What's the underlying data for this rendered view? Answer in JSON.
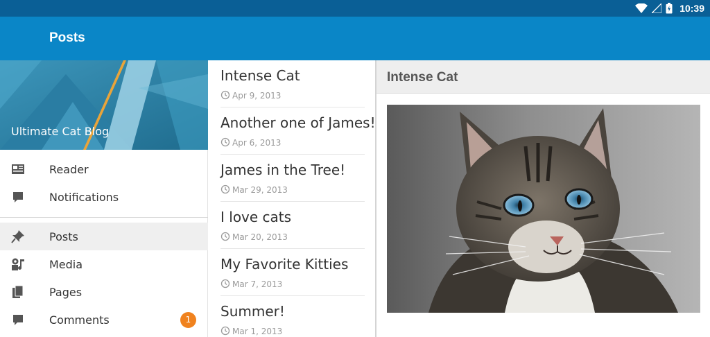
{
  "status_bar": {
    "time": "10:39",
    "icons": [
      "wifi-icon",
      "cell-signal-icon",
      "battery-icon"
    ]
  },
  "app_bar": {
    "title": "Posts"
  },
  "sidebar": {
    "blog_name": "Ultimate Cat Blog",
    "items": [
      {
        "label": "Reader",
        "icon": "reader-icon"
      },
      {
        "label": "Notifications",
        "icon": "notifications-icon"
      },
      {
        "label": "Posts",
        "icon": "pin-icon",
        "selected": true
      },
      {
        "label": "Media",
        "icon": "media-icon"
      },
      {
        "label": "Pages",
        "icon": "pages-icon"
      },
      {
        "label": "Comments",
        "icon": "comment-icon",
        "badge": "1"
      }
    ]
  },
  "posts": [
    {
      "title": "Intense Cat",
      "date": "Apr 9, 2013"
    },
    {
      "title": "Another one of James!",
      "date": "Apr 6, 2013"
    },
    {
      "title": "James in the Tree!",
      "date": "Mar 29, 2013"
    },
    {
      "title": "I love cats",
      "date": "Mar 20, 2013"
    },
    {
      "title": "My Favorite Kitties",
      "date": "Mar 7, 2013"
    },
    {
      "title": "Summer!",
      "date": "Mar 1, 2013"
    }
  ],
  "detail": {
    "title": "Intense Cat"
  },
  "colors": {
    "status_bar": "#0a5f96",
    "app_bar": "#0a86c7",
    "badge": "#f0821e",
    "selected_item": "#efefef"
  }
}
